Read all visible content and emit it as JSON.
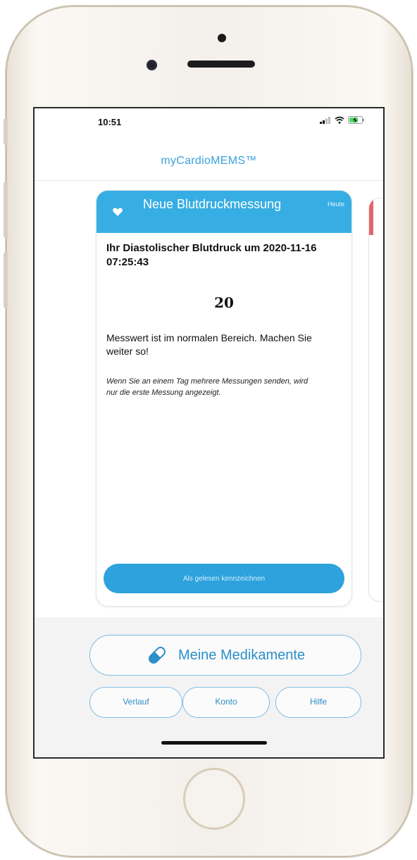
{
  "status_bar": {
    "time": "10:51",
    "signal_icon": "signal-icon",
    "wifi_icon": "wifi-icon",
    "battery_icon": "battery-charging-icon"
  },
  "app": {
    "title": "myCardioMEMS™"
  },
  "card": {
    "title": "Neue Blutdruckmessung",
    "date": "Heute",
    "icon": "heart-tag-icon",
    "headline": "Ihr Diastolischer Blutdruck um 2020-11-16 07:25:43",
    "value": "20",
    "message": "Messwert ist im normalen Bereich. Machen Sie weiter so!",
    "note": "Wenn Sie an einem Tag mehrere Messungen senden, wird nur die erste Messung angezeigt.",
    "mark_read_label": "Als gelesen kennzeichnen",
    "header_color": "#37aee3"
  },
  "next_card": {
    "accent_color": "#e3646e"
  },
  "bottom": {
    "meds_label": "Meine Medikamente",
    "meds_icon": "pill-icon",
    "nav": [
      {
        "label": "Verlauf"
      },
      {
        "label": "Konto"
      },
      {
        "label": "Hilfe"
      }
    ]
  },
  "colors": {
    "accent": "#2b8fc8",
    "button": "#2da2dc",
    "frame": "#f3efea"
  }
}
